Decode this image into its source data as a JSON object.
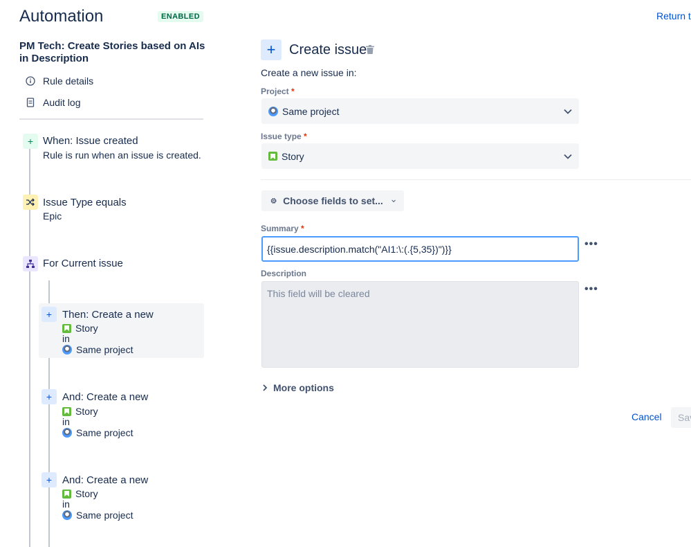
{
  "header": {
    "app_title": "Automation",
    "status_badge": "ENABLED",
    "return_link": "Return t"
  },
  "sidebar": {
    "rule_name": "PM Tech: Create Stories based on AIs in Description",
    "links": [
      {
        "label": "Rule details",
        "icon": "info-icon"
      },
      {
        "label": "Audit log",
        "icon": "document-icon"
      }
    ],
    "trigger": {
      "title": "When: Issue created",
      "subtitle": "Rule is run when an issue is created.",
      "icon": "plus-icon"
    },
    "condition": {
      "title": "Issue Type equals",
      "subtitle": "Epic",
      "icon": "shuffle-icon"
    },
    "branch": {
      "title": "For Current issue",
      "icon": "branch-icon"
    },
    "actions": [
      {
        "title": "Then: Create a new",
        "issue_type": "Story",
        "in": "in",
        "project": "Same project",
        "selected": true
      },
      {
        "title": "And: Create a new",
        "issue_type": "Story",
        "in": "in",
        "project": "Same project",
        "selected": false
      },
      {
        "title": "And: Create a new",
        "issue_type": "Story",
        "in": "in",
        "project": "Same project",
        "selected": false
      }
    ]
  },
  "panel": {
    "title": "Create issue",
    "subheading": "Create a new issue in:",
    "project": {
      "label": "Project",
      "required": "*",
      "value": "Same project"
    },
    "issue_type": {
      "label": "Issue type",
      "required": "*",
      "value": "Story"
    },
    "choose_fields": "Choose fields to set...",
    "summary": {
      "label": "Summary",
      "required": "*",
      "value": "{{issue.description.match(\"AI1:\\:(.{5,35})\")}}"
    },
    "description": {
      "label": "Description",
      "value": "This field will be cleared"
    },
    "more_options": "More options",
    "cancel": "Cancel",
    "save": "Save"
  },
  "colors": {
    "accent": "#0052cc",
    "enabled_bg": "#e3fcef",
    "enabled_text": "#006644",
    "required": "#de350b"
  }
}
